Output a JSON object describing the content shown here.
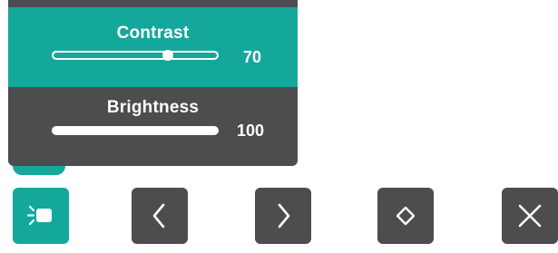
{
  "osd": {
    "contrast": {
      "label": "Contrast",
      "value": "70",
      "level": 0.7
    },
    "brightness": {
      "label": "Brightness",
      "value": "100",
      "level": 1.0
    }
  },
  "buttons": [
    {
      "icon": "picture-mode-icon",
      "active": true
    },
    {
      "icon": "chevron-left-icon",
      "active": false
    },
    {
      "icon": "chevron-right-icon",
      "active": false
    },
    {
      "icon": "diamond-select-icon",
      "active": false
    },
    {
      "icon": "close-icon",
      "active": false
    }
  ],
  "colors": {
    "accent": "#14a89c",
    "panel": "#4d4d4f",
    "text": "#ffffff"
  }
}
